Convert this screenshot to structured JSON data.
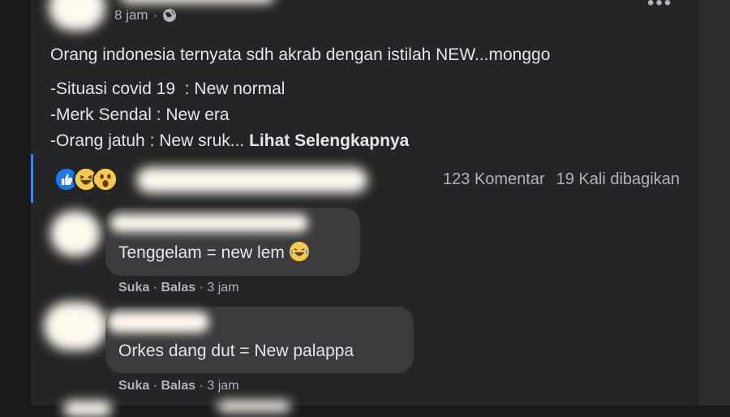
{
  "post": {
    "time": "8 jam",
    "separator": "·",
    "privacy_icon": "globe-icon",
    "lines": [
      "Orang indonesia ternyata sdh akrab dengan istilah NEW...monggo",
      "-Situasi covid 19  : New normal",
      "-Merk Sendal : New era",
      "-Orang jatuh : New sruk... "
    ],
    "see_more": "Lihat Selengkapnya"
  },
  "reactions": {
    "icons": [
      "like-icon",
      "haha-icon",
      "wow-icon"
    ],
    "comments_count": "123 Komentar",
    "shares_count": "19 Kali dibagikan"
  },
  "comments": [
    {
      "text": "Tenggelam = new lem",
      "emoji": "laughing-emoji-icon",
      "like": "Suka",
      "reply": "Balas",
      "time": "3 jam"
    },
    {
      "text": "Orkes dang dut = New palappa",
      "like": "Suka",
      "reply": "Balas",
      "time": "3 jam"
    }
  ],
  "colors": {
    "background": "#18191a",
    "card": "#242526",
    "bubble": "#3a3b3c",
    "text": "#e4e6eb",
    "muted": "#b0b3b8",
    "accent": "#2d88ff"
  }
}
